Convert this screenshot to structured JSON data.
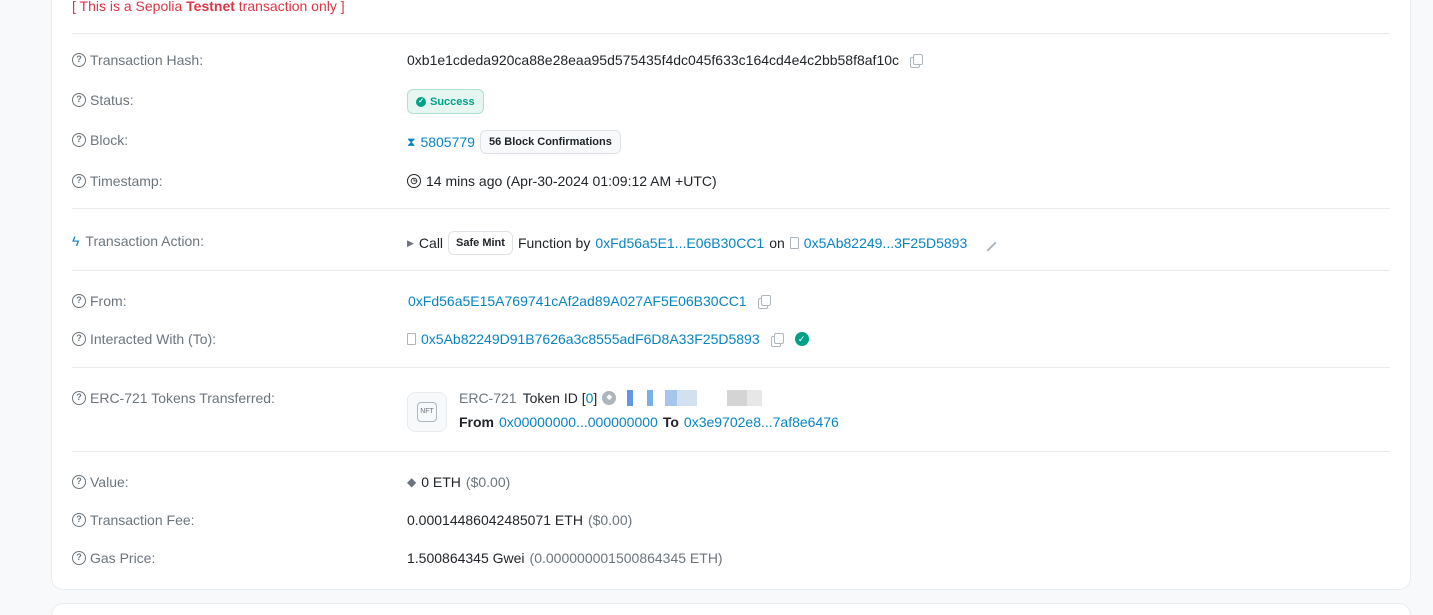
{
  "notice": {
    "prefix": "[ This is a Sepolia ",
    "bold": "Testnet",
    "suffix": " transaction only ]"
  },
  "rows": {
    "tx_hash": {
      "label": "Transaction Hash:",
      "value": "0xb1e1cdeda920ca88e28eaa95d575435f4dc045f633c164cd4e4c2bb58f8af10c"
    },
    "status": {
      "label": "Status:",
      "value": "Success"
    },
    "block": {
      "label": "Block:",
      "value": "5805779",
      "confirmations": "56 Block Confirmations"
    },
    "timestamp": {
      "label": "Timestamp:",
      "value": "14 mins ago (Apr-30-2024 01:09:12 AM +UTC)"
    },
    "action": {
      "label": "Transaction Action:",
      "call": "Call",
      "method": "Safe Mint",
      "function_by": "Function by",
      "from_addr": "0xFd56a5E1...E06B30CC1",
      "on": "on",
      "to_addr": "0x5Ab82249...3F25D5893"
    },
    "from": {
      "label": "From:",
      "value": "0xFd56a5E15A769741cAf2ad89A027AF5E06B30CC1"
    },
    "to": {
      "label": "Interacted With (To):",
      "value": "0x5Ab82249D91B7626a3c8555adF6D8A33F25D5893"
    },
    "erc721": {
      "label": "ERC-721 Tokens Transferred:",
      "standard": "ERC-721",
      "token_id_label": "Token ID [",
      "token_id": "0",
      "token_id_close": "]",
      "from_label": "From",
      "from_addr": "0x00000000...000000000",
      "to_label": "To",
      "to_addr": "0x3e9702e8...7af8e6476",
      "nft_icon_text": "NFT"
    },
    "value": {
      "label": "Value:",
      "amount": "0 ETH",
      "usd": "($0.00)"
    },
    "fee": {
      "label": "Transaction Fee:",
      "amount": "0.00014486042485071 ETH",
      "usd": "($0.00)"
    },
    "gas": {
      "label": "Gas Price:",
      "amount": "1.500864345 Gwei",
      "eth": "(0.000000001500864345 ETH)"
    }
  },
  "colors": {
    "link": "#0784c3",
    "success": "#00a186",
    "notice": "#dc3545",
    "label": "#6c757d"
  }
}
